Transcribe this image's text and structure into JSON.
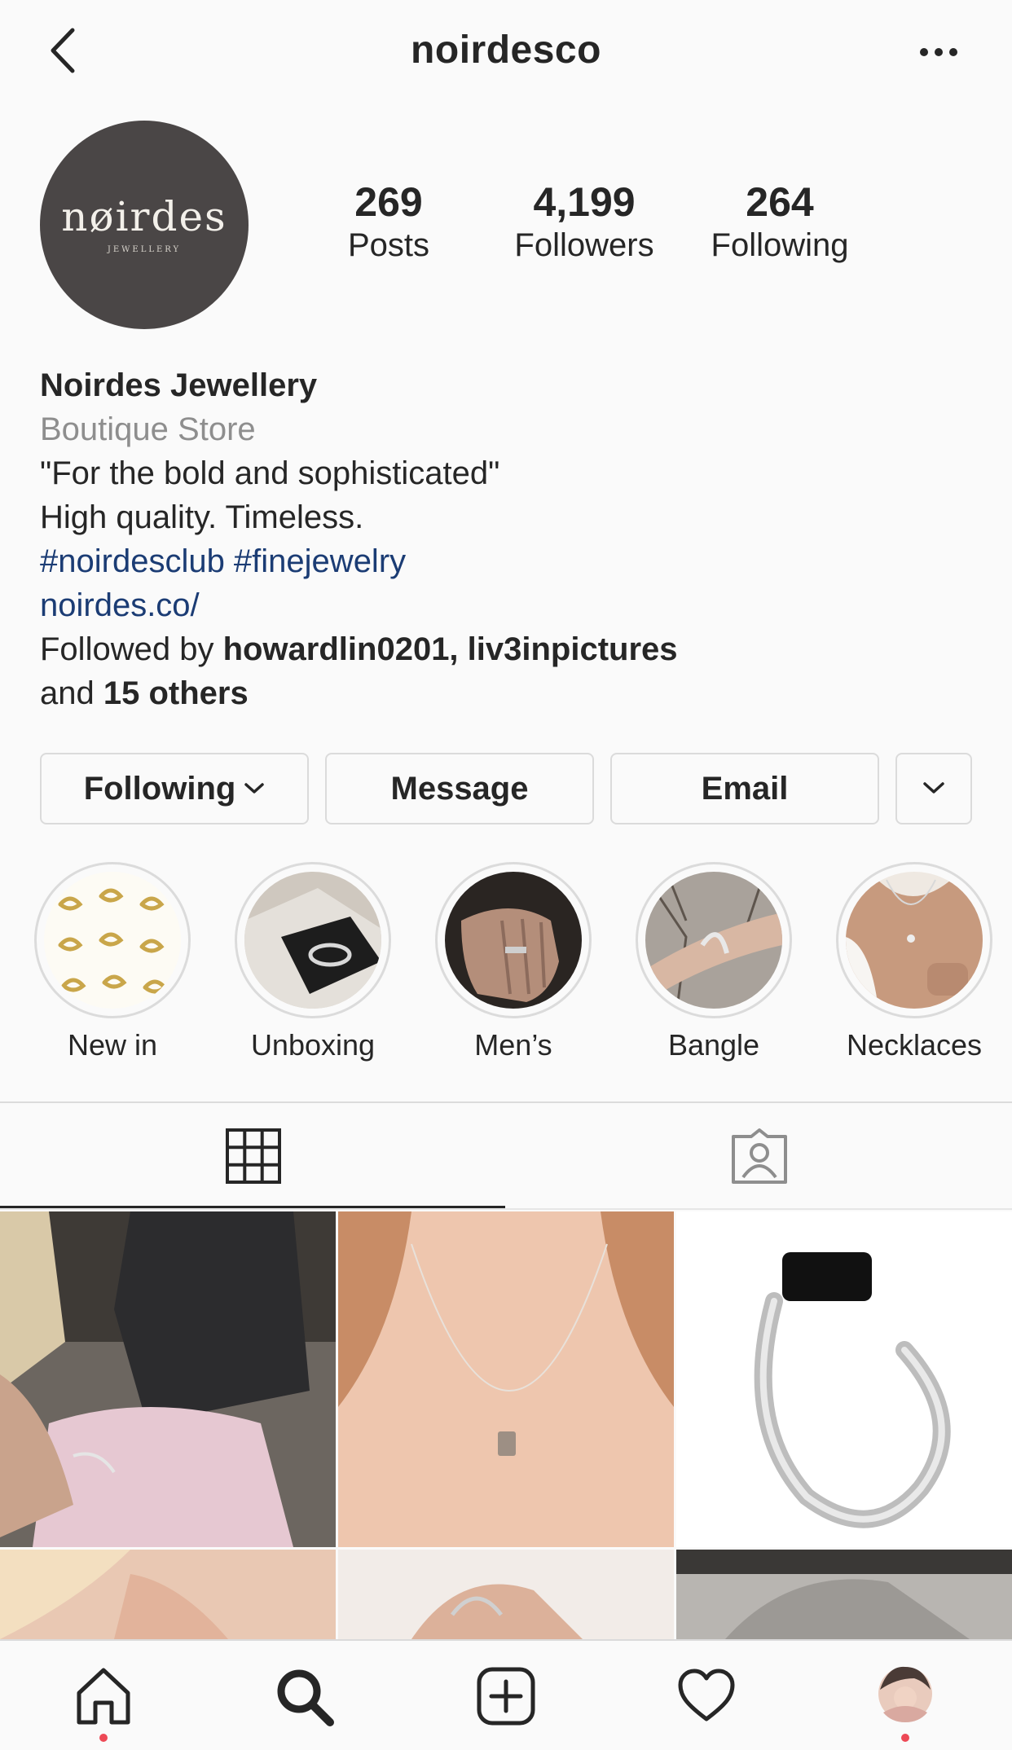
{
  "header": {
    "username": "noirdesco"
  },
  "profile": {
    "avatar_word": "nøirdes",
    "avatar_sub": "JEWELLERY",
    "stats": [
      {
        "num": "269",
        "label": "Posts"
      },
      {
        "num": "4,199",
        "label": "Followers"
      },
      {
        "num": "264",
        "label": "Following"
      }
    ]
  },
  "bio": {
    "name": "Noirdes Jewellery",
    "category": "Boutique Store",
    "line1": "\"For the bold and sophisticated\"",
    "line2": "High quality. Timeless.",
    "hashtags": "#noirdesclub #finejewelry",
    "link": "noirdes.co/",
    "followed_prefix": "Followed by ",
    "followed_users": "howardlin0201, liv3inpictures",
    "followed_and": "and ",
    "followed_others": "15 others"
  },
  "actions": {
    "following": "Following",
    "message": "Message",
    "email": "Email"
  },
  "highlights": [
    {
      "label": "New in"
    },
    {
      "label": "Unboxing"
    },
    {
      "label": "Men’s"
    },
    {
      "label": "Bangle"
    },
    {
      "label": "Necklaces"
    }
  ],
  "colors": {
    "link": "#1b3c74",
    "muted": "#8e8e8e",
    "border": "#dbdbdb",
    "notification": "#ed4956"
  }
}
